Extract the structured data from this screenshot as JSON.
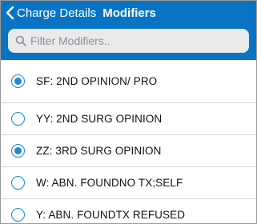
{
  "header": {
    "back_label": "Charge Details",
    "title": "Modifiers"
  },
  "search": {
    "placeholder": "Filter Modifiers..",
    "value": ""
  },
  "colors": {
    "header_bg": "#0a74c4",
    "accent": "#1e88d2",
    "search_bg": "#e9eaec"
  },
  "modifiers": [
    {
      "label": "SF: 2ND OPINION/ PRO",
      "selected": true
    },
    {
      "label": "YY: 2ND SURG OPINION",
      "selected": false
    },
    {
      "label": "ZZ: 3RD SURG OPINION",
      "selected": true
    },
    {
      "label": "W: ABN. FOUNDNO TX;SELF",
      "selected": false
    },
    {
      "label": "Y: ABN. FOUNDTX REFUSED",
      "selected": false
    }
  ]
}
